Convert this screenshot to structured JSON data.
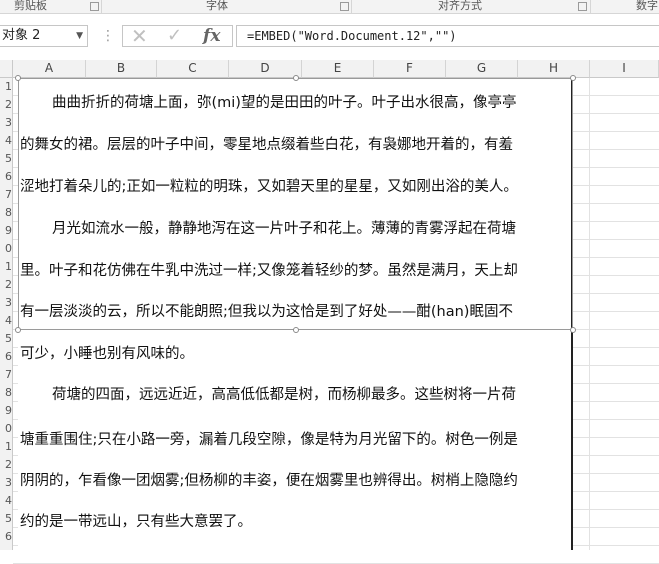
{
  "ribbon": {
    "groups": [
      "剪贴板",
      "字体",
      "对齐方式",
      "数字"
    ]
  },
  "formula_bar": {
    "name_box": "对象 2",
    "formula": "=EMBED(\"Word.Document.12\",\"\")",
    "cancel_label": "✕",
    "enter_label": "✓",
    "fx_label": "fx"
  },
  "columns": [
    "A",
    "B",
    "C",
    "D",
    "E",
    "F",
    "G",
    "H",
    "I"
  ],
  "row_numbers": [
    "1",
    "2",
    "3",
    "4",
    "5",
    "6",
    "7",
    "8",
    "9",
    "0",
    "1",
    "2",
    "3",
    "4",
    "5",
    "6",
    "7",
    "8",
    "9",
    "0",
    "1",
    "2",
    "3",
    "4",
    "5",
    "6",
    "7"
  ],
  "document": {
    "lines": [
      "曲曲折折的荷塘上面，弥(mi)望的是田田的叶子。叶子出水很高，像亭亭",
      "的舞女的裙。层层的叶子中间，零星地点缀着些白花，有袅娜地开着的，有羞",
      "涩地打着朵儿的;正如一粒粒的明珠，又如碧天里的星星，又如刚出浴的美人。",
      "月光如流水一般，静静地泻在这一片叶子和花上。薄薄的青雾浮起在荷塘",
      "里。叶子和花仿佛在牛乳中洗过一样;又像笼着轻纱的梦。虽然是满月，天上却",
      "有一层淡淡的云，所以不能朗照;但我以为这恰是到了好处——酣(han)眠固不",
      "可少，小睡也别有风味的。",
      "荷塘的四面，远远近近，高高低低都是树，而杨柳最多。这些树将一片荷",
      "塘重重围住;只在小路一旁，漏着几段空隙，像是特为月光留下的。树色一例是",
      "阴阴的，乍看像一团烟雾;但杨柳的丰姿，便在烟雾里也辨得出。树梢上隐隐约",
      "约的是一带远山，只有些大意罢了。"
    ]
  }
}
